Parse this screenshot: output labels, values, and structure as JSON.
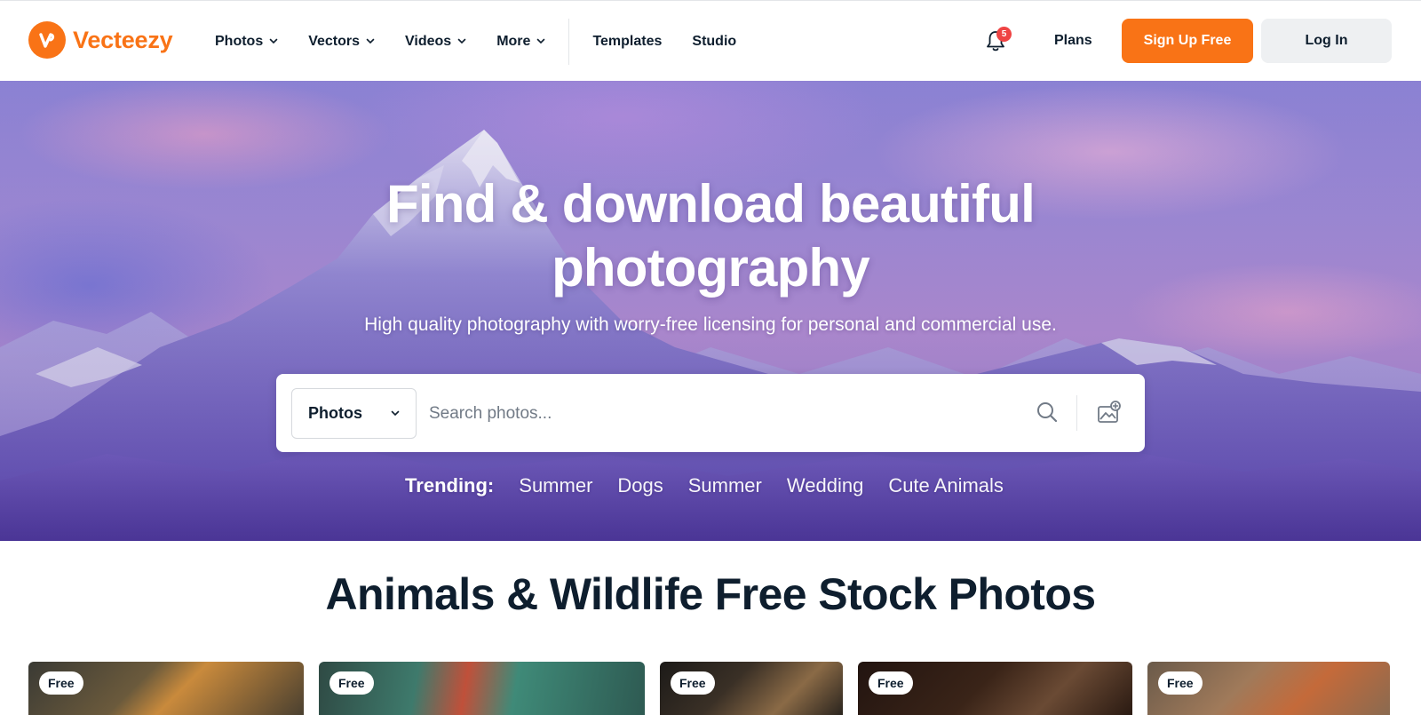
{
  "header": {
    "brand": "Vecteezy",
    "nav": [
      {
        "label": "Photos",
        "dropdown": true
      },
      {
        "label": "Vectors",
        "dropdown": true
      },
      {
        "label": "Videos",
        "dropdown": true
      },
      {
        "label": "More",
        "dropdown": true
      },
      {
        "label": "Templates",
        "dropdown": false
      },
      {
        "label": "Studio",
        "dropdown": false
      }
    ],
    "notification_count": "5",
    "plans_label": "Plans",
    "signup_label": "Sign Up Free",
    "login_label": "Log In"
  },
  "hero": {
    "title_line1": "Find & download beautiful",
    "title_line2": "photography",
    "subtitle": "High quality photography with worry-free licensing for personal and commercial use.",
    "search": {
      "type_selected": "Photos",
      "placeholder": "Search photos..."
    },
    "trending_label": "Trending:",
    "trending": [
      "Summer",
      "Dogs",
      "Summer",
      "Wedding",
      "Cute Animals"
    ]
  },
  "section": {
    "title": "Animals & Wildlife Free Stock Photos",
    "cards": [
      {
        "badge": "Free",
        "subject": "tiger"
      },
      {
        "badge": "Free",
        "subject": "chameleon"
      },
      {
        "badge": "Free",
        "subject": "lynx"
      },
      {
        "badge": "Free",
        "subject": "deer"
      },
      {
        "badge": "Free",
        "subject": "red-panda"
      }
    ]
  },
  "colors": {
    "brand": "#f97316",
    "text": "#0e1e2e",
    "badge": "#ef4444"
  }
}
